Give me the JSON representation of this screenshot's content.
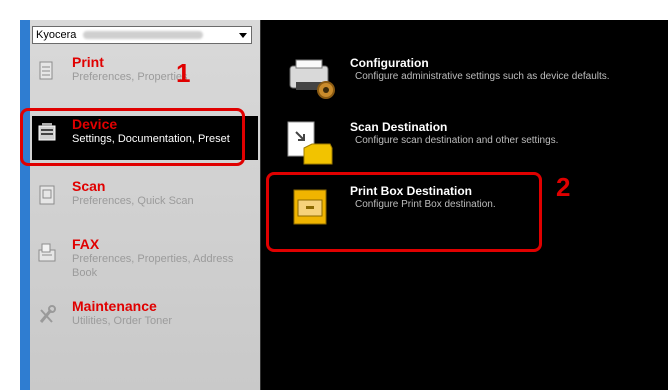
{
  "dropdown": {
    "value": "Kyocera"
  },
  "nav": [
    {
      "id": "print",
      "title": "Print",
      "sub": "Preferences, Properties"
    },
    {
      "id": "device",
      "title": "Device",
      "sub": "Settings, Documentation, Preset"
    },
    {
      "id": "scan",
      "title": "Scan",
      "sub": "Preferences, Quick Scan"
    },
    {
      "id": "fax",
      "title": "FAX",
      "sub": "Preferences, Properties, Address Book"
    },
    {
      "id": "maintenance",
      "title": "Maintenance",
      "sub": "Utilities, Order Toner"
    }
  ],
  "items": [
    {
      "title": "Configuration",
      "desc": "Configure administrative settings such as device defaults."
    },
    {
      "title": "Scan Destination",
      "desc": "Configure scan destination and other settings."
    },
    {
      "title": "Print Box Destination",
      "desc": "Configure Print Box destination."
    }
  ],
  "callouts": {
    "one": "1",
    "two": "2"
  }
}
